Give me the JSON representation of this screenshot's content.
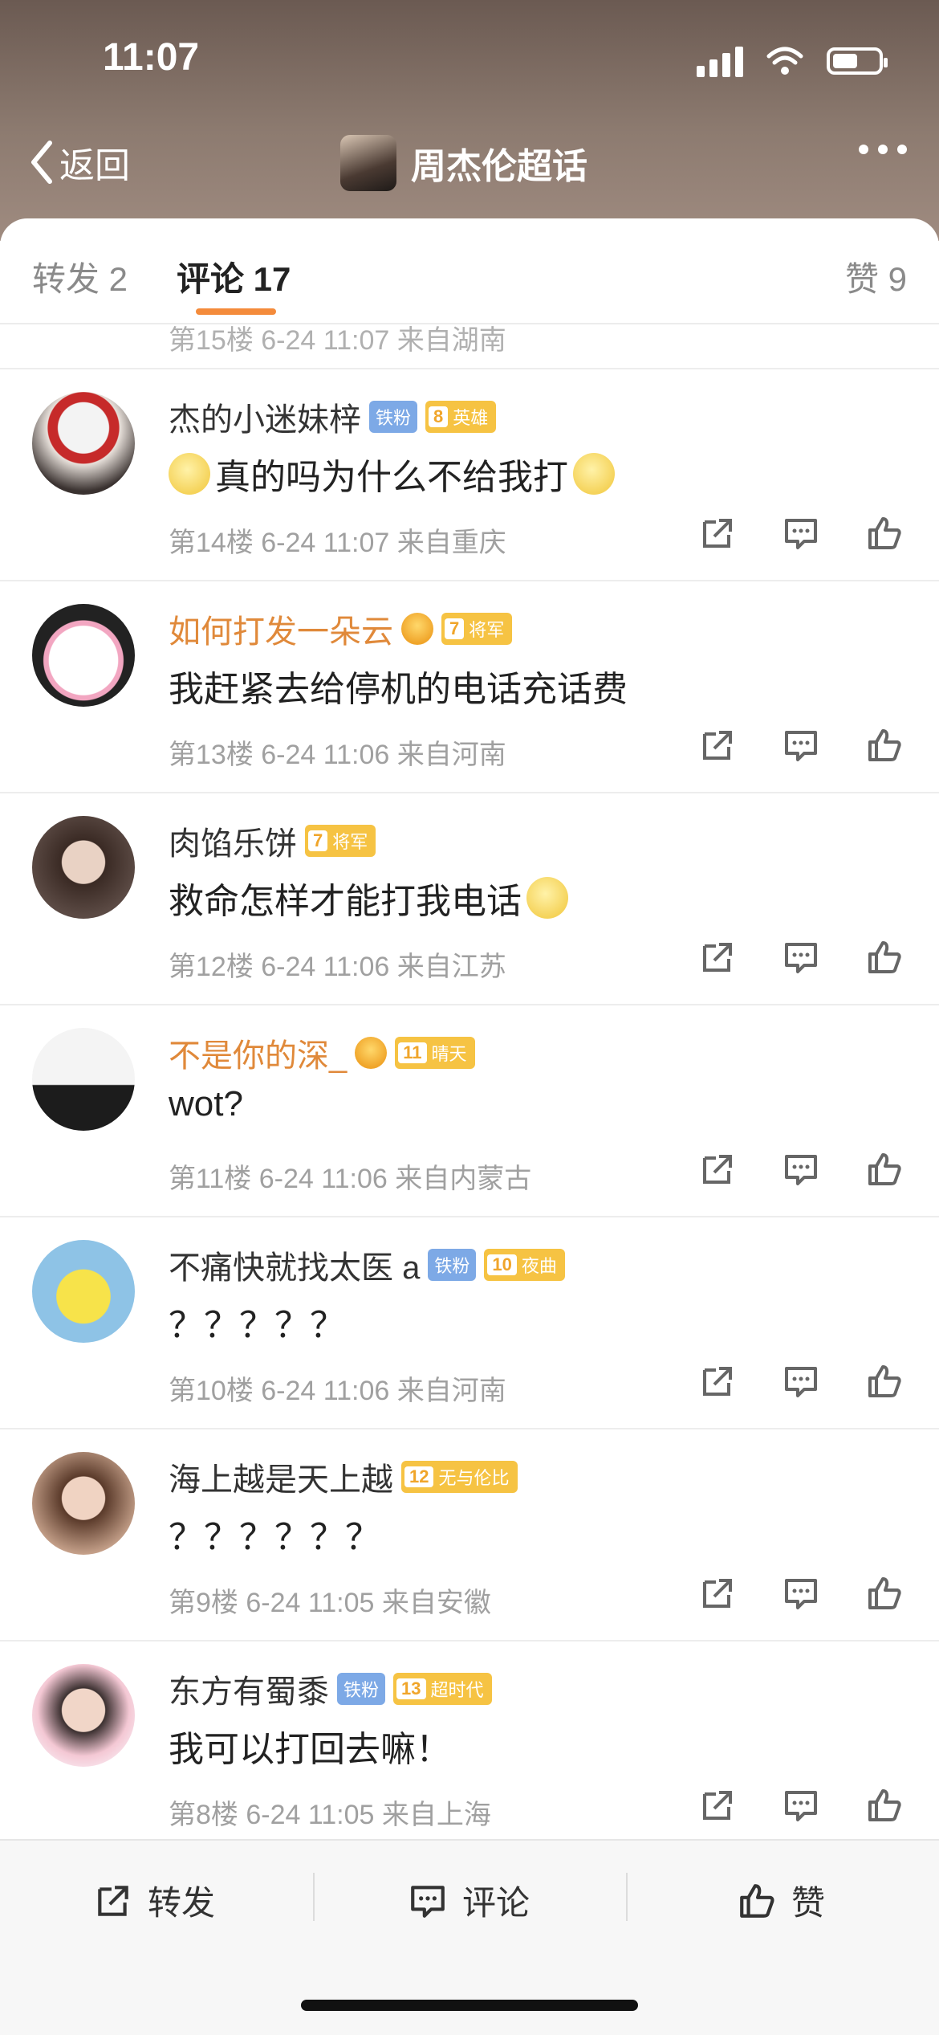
{
  "status_bar": {
    "time": "11:07"
  },
  "header": {
    "back_label": "返回",
    "title": "周杰伦超话"
  },
  "tabs": [
    {
      "label": "转发 2"
    },
    {
      "label": "评论 17"
    },
    {
      "label": "赞 9"
    }
  ],
  "partial_row": {
    "meta": "第15楼 6-24 11:07 来自湖南"
  },
  "comments": [
    {
      "name": "杰的小迷妹梓",
      "fan_badge": "铁粉",
      "level": "8",
      "level_title": "英雄",
      "text": "真的吗为什么不给我打",
      "meta": "第14楼 6-24 11:07 来自重庆"
    },
    {
      "name": "如何打发一朵云",
      "level": "7",
      "level_title": "将军",
      "text": "我赶紧去给停机的电话充话费",
      "meta": "第13楼 6-24 11:06 来自河南"
    },
    {
      "name": "肉馅乐饼",
      "level": "7",
      "level_title": "将军",
      "text": "救命怎样才能打我电话",
      "meta": "第12楼 6-24 11:06 来自江苏"
    },
    {
      "name": "不是你的深_",
      "level": "11",
      "level_title": "晴天",
      "text": "wot?",
      "meta": "第11楼 6-24 11:06 来自内蒙古"
    },
    {
      "name": "不痛快就找太医 a",
      "fan_badge": "铁粉",
      "level": "10",
      "level_title": "夜曲",
      "text": "？？？？？",
      "meta": "第10楼 6-24 11:06 来自河南"
    },
    {
      "name": "海上越是天上越",
      "level": "12",
      "level_title": "无与伦比",
      "text": "？？？？？？",
      "meta": "第9楼 6-24 11:05 来自安徽"
    },
    {
      "name": "东方有蜀黍",
      "fan_badge": "铁粉",
      "level": "13",
      "level_title": "超时代",
      "text": "我可以打回去嘛！",
      "meta": "第8楼 6-24 11:05 来自上海"
    }
  ],
  "bottom_bar": {
    "repost": "转发",
    "comment": "评论",
    "like": "赞"
  }
}
